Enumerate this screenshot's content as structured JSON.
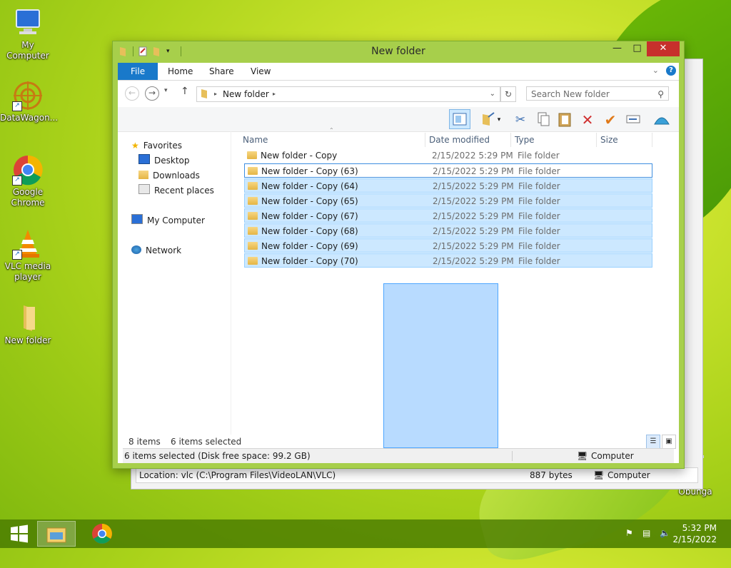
{
  "desktop": {
    "icons": [
      {
        "label": "My Computer"
      },
      {
        "label": "DataWagon..."
      },
      {
        "label": "Google Chrome"
      },
      {
        "label": "VLC media player"
      },
      {
        "label": "New folder"
      },
      {
        "label": "Obunga"
      }
    ]
  },
  "back_window": {
    "status_location": "Location: vlc (C:\\Program Files\\VideoLAN\\VLC)",
    "status_size": "887 bytes",
    "status_computer": "Computer"
  },
  "window": {
    "title": "New folder",
    "minimize": "—",
    "maximize": "□",
    "close": "✕",
    "ribbon_tabs": [
      "File",
      "Home",
      "Share",
      "View"
    ],
    "address": {
      "current": "New folder"
    },
    "search_placeholder": "Search New folder",
    "nav": {
      "favorites": "Favorites",
      "desktop": "Desktop",
      "downloads": "Downloads",
      "recent": "Recent places",
      "computer": "My Computer",
      "network": "Network"
    },
    "columns": [
      "Name",
      "Date modified",
      "Type",
      "Size"
    ],
    "files": [
      {
        "name": "New folder - Copy",
        "date": "2/15/2022 5:29 PM",
        "type": "File folder",
        "selected": false
      },
      {
        "name": "New folder - Copy (63)",
        "date": "2/15/2022 5:29 PM",
        "type": "File folder",
        "selected": true
      },
      {
        "name": "New folder - Copy (64)",
        "date": "2/15/2022 5:29 PM",
        "type": "File folder",
        "selected": true
      },
      {
        "name": "New folder - Copy (65)",
        "date": "2/15/2022 5:29 PM",
        "type": "File folder",
        "selected": true
      },
      {
        "name": "New folder - Copy (67)",
        "date": "2/15/2022 5:29 PM",
        "type": "File folder",
        "selected": true
      },
      {
        "name": "New folder - Copy (68)",
        "date": "2/15/2022 5:29 PM",
        "type": "File folder",
        "selected": true
      },
      {
        "name": "New folder - Copy (69)",
        "date": "2/15/2022 5:29 PM",
        "type": "File folder",
        "selected": true
      },
      {
        "name": "New folder - Copy (70)",
        "date": "2/15/2022 5:29 PM",
        "type": "File folder",
        "selected": true
      }
    ],
    "status_items": "8 items",
    "status_selected": "6 items selected",
    "bottom_status": "6 items selected (Disk free space: 99.2 GB)",
    "bottom_computer": "Computer"
  },
  "taskbar": {
    "time": "5:32 PM",
    "date": "2/15/2022"
  },
  "colors": {
    "accent": "#1979ca",
    "selection": "#cce8ff",
    "window_frame": "#a7cf4b",
    "close": "#c7302c"
  }
}
